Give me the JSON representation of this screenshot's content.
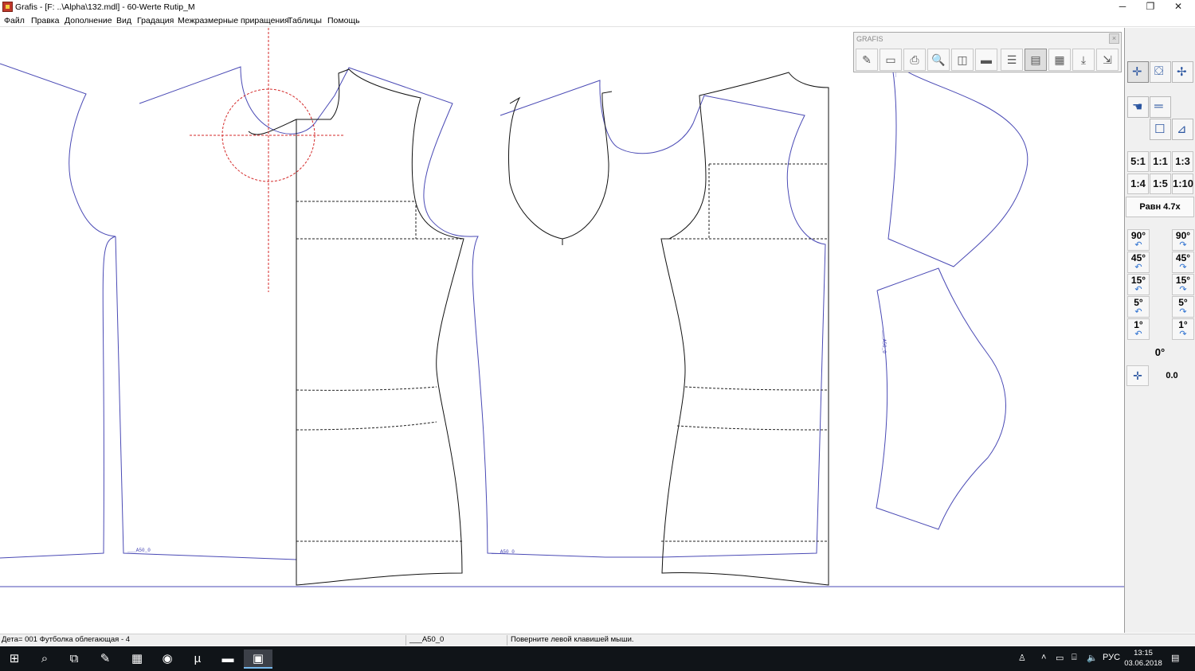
{
  "window": {
    "title": "Grafis - [F: ..\\Alpha\\132.mdl] - 60-Werte Rutip_M",
    "minimize": "─",
    "maximize": "❐",
    "close": "✕"
  },
  "menu": [
    "Файл",
    "Правка",
    "Дополнение",
    "Вид",
    "Градация",
    "Межразмерные приращения",
    "Таблицы",
    "Помощь"
  ],
  "grafis_toolbar": {
    "title": "GRAFIS",
    "close": "×",
    "tools": [
      {
        "icon": "curve-edit-icon",
        "glyph": "✎"
      },
      {
        "icon": "save-icon",
        "glyph": "▭"
      },
      {
        "icon": "print-icon",
        "glyph": "⎙"
      },
      {
        "icon": "magnifier-icon",
        "glyph": "🔍"
      },
      {
        "icon": "layer-icon",
        "glyph": "◫"
      },
      {
        "icon": "measure-tape-icon",
        "glyph": "▬"
      },
      {
        "icon": "list-icon",
        "glyph": "☰"
      },
      {
        "icon": "table-icon",
        "glyph": "▤"
      },
      {
        "icon": "grid-icon",
        "glyph": "▦"
      },
      {
        "icon": "download-icon",
        "glyph": "⤓"
      },
      {
        "icon": "align-icon",
        "glyph": "⇲"
      }
    ]
  },
  "right_panel": {
    "scales": [
      "5:1",
      "1:1",
      "1:3",
      "1:4",
      "1:5",
      "1:10"
    ],
    "zoom_label": "Равн 4.7x",
    "rotations": [
      "90°",
      "45°",
      "15°",
      "5°",
      "1°"
    ],
    "zero_label": "0°",
    "rotation_value": "0.0",
    "rotate_ccw_glyph": "↶",
    "rotate_cw_glyph": "↷"
  },
  "pattern": {
    "piece_labels": [
      "___A50_0",
      "___A50_0"
    ],
    "sleeve_labels": [
      "___A50_0",
      "___A50_0"
    ]
  },
  "status": {
    "piece": "Дета= 001  Футболка облегающая - 4",
    "size": "___A50_0",
    "hint": "Поверните левой клавишей мыши."
  },
  "taskbar": {
    "clock_time": "13:15",
    "clock_date": "03.06.2018",
    "language": "РУС"
  },
  "colors": {
    "pattern_blue": "#4a4ab5",
    "pattern_black": "#111111",
    "crosshair_red": "#d42a2a"
  }
}
